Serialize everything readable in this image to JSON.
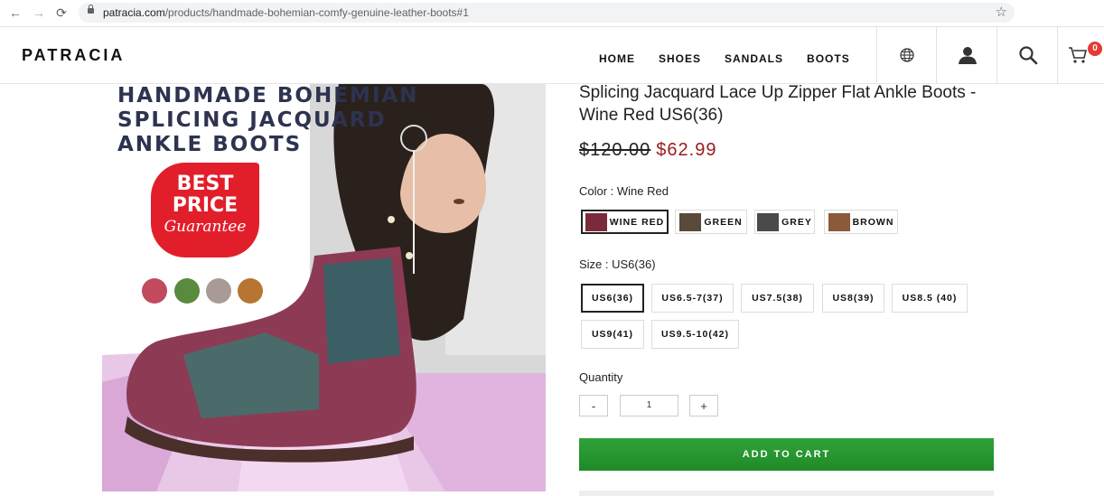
{
  "browser": {
    "back": "←",
    "forward": "→",
    "reload": "⟳",
    "url_domain": "patracia.com",
    "url_path": "/products/handmade-bohemian-comfy-genuine-leather-boots#1",
    "star": "☆"
  },
  "header": {
    "logo": "PATRACIA",
    "nav": [
      "HOME",
      "SHOES",
      "SANDALS",
      "BOOTS"
    ],
    "cart_count": "0"
  },
  "hero": {
    "headline_lines": [
      "HANDMADE BOHEMIAN",
      "SPLICING JACQUARD",
      "ANKLE BOOTS"
    ],
    "badge_line1": "BEST",
    "badge_line2": "PRICE",
    "badge_line3": "Guarantee",
    "dot_colors": [
      "#c14a5e",
      "#5a8a3e",
      "#a89b96",
      "#b87431"
    ]
  },
  "product": {
    "title": "Splicing Jacquard Lace Up Zipper Flat Ankle Boots - Wine Red US6(36)",
    "price_old": "$120.00",
    "price_new": "$62.99",
    "color_label": "Color : Wine Red",
    "colors": [
      {
        "label": "WINE RED",
        "swatch": "#7a2a3a",
        "selected": true
      },
      {
        "label": "GREEN",
        "swatch": "#5a4a3a",
        "selected": false
      },
      {
        "label": "GREY",
        "swatch": "#4a4a4a",
        "selected": false
      },
      {
        "label": "BROWN",
        "swatch": "#8a5a3a",
        "selected": false
      }
    ],
    "size_label": "Size : US6(36)",
    "sizes": [
      "US6(36)",
      "US6.5-7(37)",
      "US7.5(38)",
      "US8(39)",
      "US8.5 (40)",
      "US9(41)",
      "US9.5-10(42)"
    ],
    "selected_size": "US6(36)",
    "quantity_label": "Quantity",
    "minus": "-",
    "plus": "+",
    "quantity": "1",
    "add_to_cart": "ADD TO CART"
  },
  "colors": {
    "accent_green": "#2a9a33",
    "sale_red": "#9b1b1b",
    "badge_red": "#e53935"
  }
}
